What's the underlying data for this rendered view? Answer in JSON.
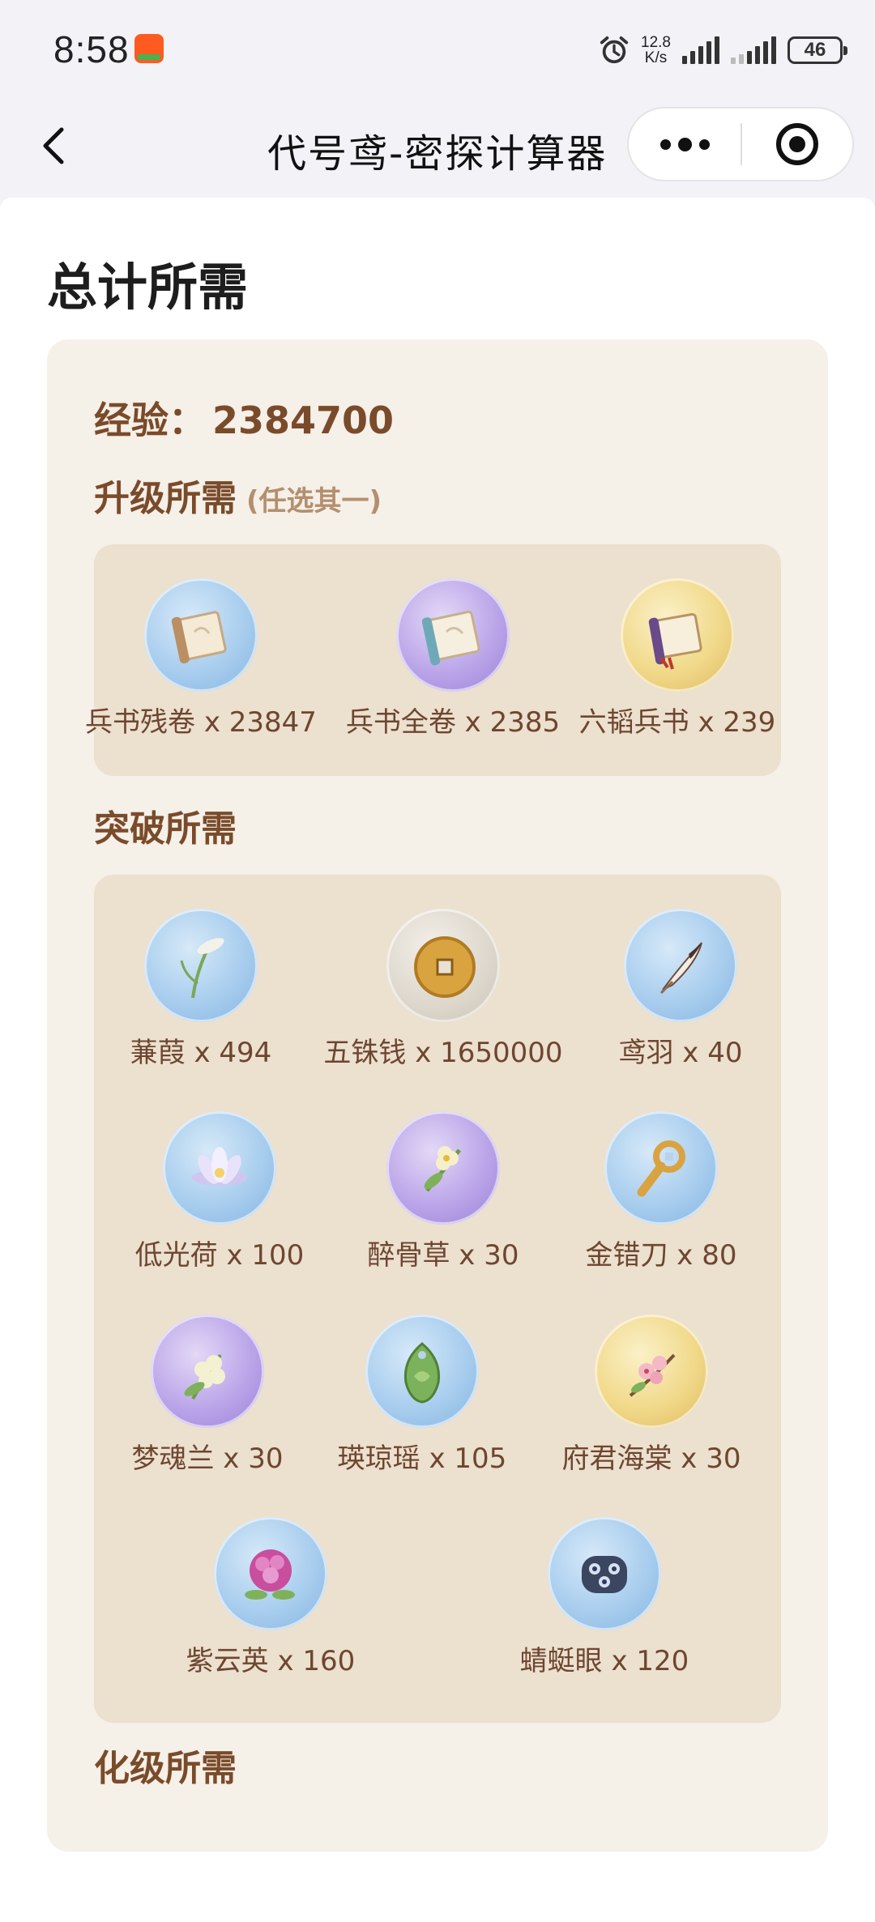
{
  "status_bar": {
    "time": "8:58",
    "net_speed_value": "12.8",
    "net_speed_unit": "K/s",
    "battery": "46"
  },
  "nav": {
    "title": "代号鸢-密探计算器"
  },
  "page": {
    "title": "总计所需",
    "exp_label": "经验：",
    "exp_value": "2384700",
    "sections": {
      "upgrade": {
        "title": "升级所需",
        "note": "(任选其一)",
        "items": [
          {
            "label": "兵书残卷 x 23847",
            "icon": "scroll-fragment-icon"
          },
          {
            "label": "兵书全卷 x 2385",
            "icon": "scroll-full-icon"
          },
          {
            "label": "六韬兵书 x 239",
            "icon": "liutao-scroll-icon"
          }
        ]
      },
      "breakthrough": {
        "title": "突破所需",
        "items": [
          {
            "label": "蒹葭 x 494",
            "icon": "reed-icon"
          },
          {
            "label": "五铢钱 x 1650000",
            "icon": "coin-icon"
          },
          {
            "label": "鸢羽 x 40",
            "icon": "feather-icon"
          },
          {
            "label": "低光荷 x 100",
            "icon": "lotus-icon"
          },
          {
            "label": "醉骨草 x 30",
            "icon": "herb-flower-icon"
          },
          {
            "label": "金错刀 x 80",
            "icon": "gold-knife-coin-icon"
          },
          {
            "label": "梦魂兰 x 30",
            "icon": "orchid-icon"
          },
          {
            "label": "瑛琼瑶 x 105",
            "icon": "jade-pendant-icon"
          },
          {
            "label": "府君海棠 x 30",
            "icon": "begonia-icon"
          },
          {
            "label": "紫云英 x 160",
            "icon": "clover-flower-icon"
          },
          {
            "label": "蜻蜓眼 x 120",
            "icon": "dragonfly-eye-bead-icon"
          }
        ]
      },
      "transform": {
        "title": "化级所需"
      }
    }
  }
}
